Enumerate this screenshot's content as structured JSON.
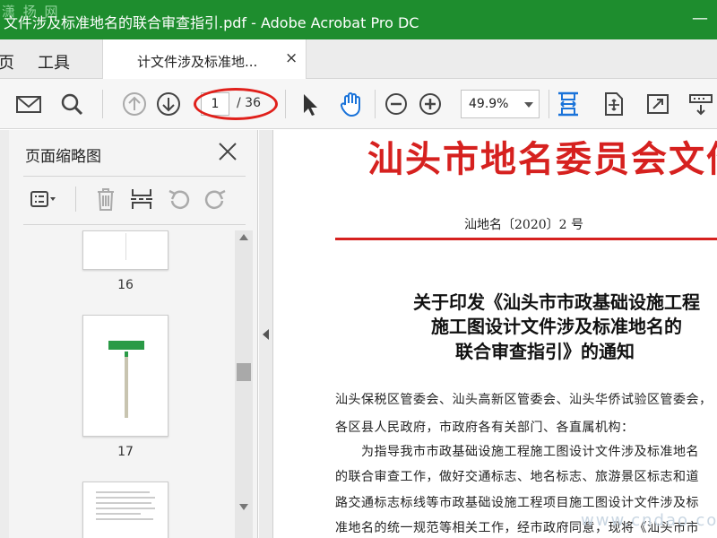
{
  "app": {
    "window_title": "文件涉及标准地名的联合审查指引.pdf - Adobe Acrobat Pro DC",
    "watermark_top": "潇 扬 网",
    "minimize_glyph": "—"
  },
  "tabs": {
    "home_label": "页",
    "tools_label": "工具",
    "doc_tab_label": "计文件涉及标准地...",
    "doc_tab_close": "×"
  },
  "toolbar": {
    "page_current": "1",
    "page_total": "/ 36",
    "zoom_value": "49.9%"
  },
  "left_panel": {
    "title": "页面缩略图",
    "thumbnails": [
      {
        "label": "16"
      },
      {
        "label": "17"
      }
    ]
  },
  "document": {
    "header": "汕头市地名委员会文件",
    "doc_number": "汕地名〔2020〕2 号",
    "heading_lines": [
      "关于印发《汕头市市政基础设施工程",
      "施工图设计文件涉及标准地名的",
      "联合审查指引》的通知"
    ],
    "body_lines": [
      "汕头保税区管委会、汕头高新区管委会、汕头华侨试验区管委会，",
      "各区县人民政府，市政府各有关部门、各直属机构：",
      "　　为指导我市市政基础设施工程施工图设计文件涉及标准地名",
      "的联合审查工作，做好交通标志、地名标志、旅游景区标志和道",
      "路交通标志标线等市政基础设施工程项目施工图设计文件涉及标",
      "准地名的统一规范等相关工作，经市政府同意，现将《汕头市市"
    ]
  },
  "watermark_site": "www.cndao.com",
  "colors": {
    "titlebar": "#1e8d2e",
    "accent_blue": "#1a73d9",
    "doc_red": "#d6211f",
    "annotation_red": "#e0201b"
  }
}
